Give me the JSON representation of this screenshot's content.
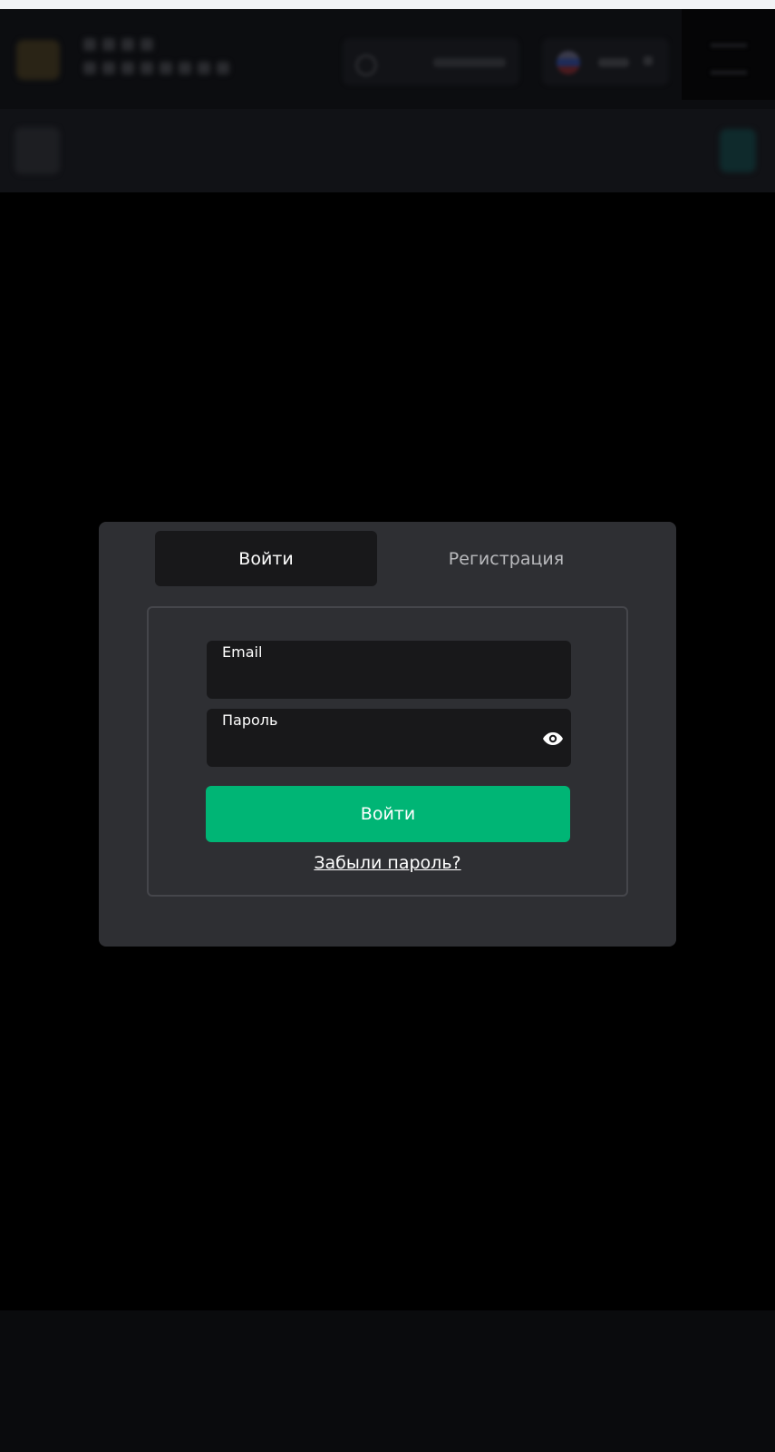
{
  "modal": {
    "tabs": [
      {
        "label": "Войти",
        "active": true
      },
      {
        "label": "Регистрация",
        "active": false
      }
    ],
    "form": {
      "email": {
        "label": "Email",
        "value": "",
        "placeholder": ""
      },
      "password": {
        "label": "Пароль",
        "value": "",
        "placeholder": ""
      },
      "submit_label": "Войти",
      "forgot_label": "Забыли пароль?"
    }
  },
  "icons": {
    "password_toggle": "eye-icon"
  },
  "colors": {
    "page_background": "#000000",
    "modal_background": "#2e2f33",
    "field_background": "#18181a",
    "accent": "#00b575"
  }
}
